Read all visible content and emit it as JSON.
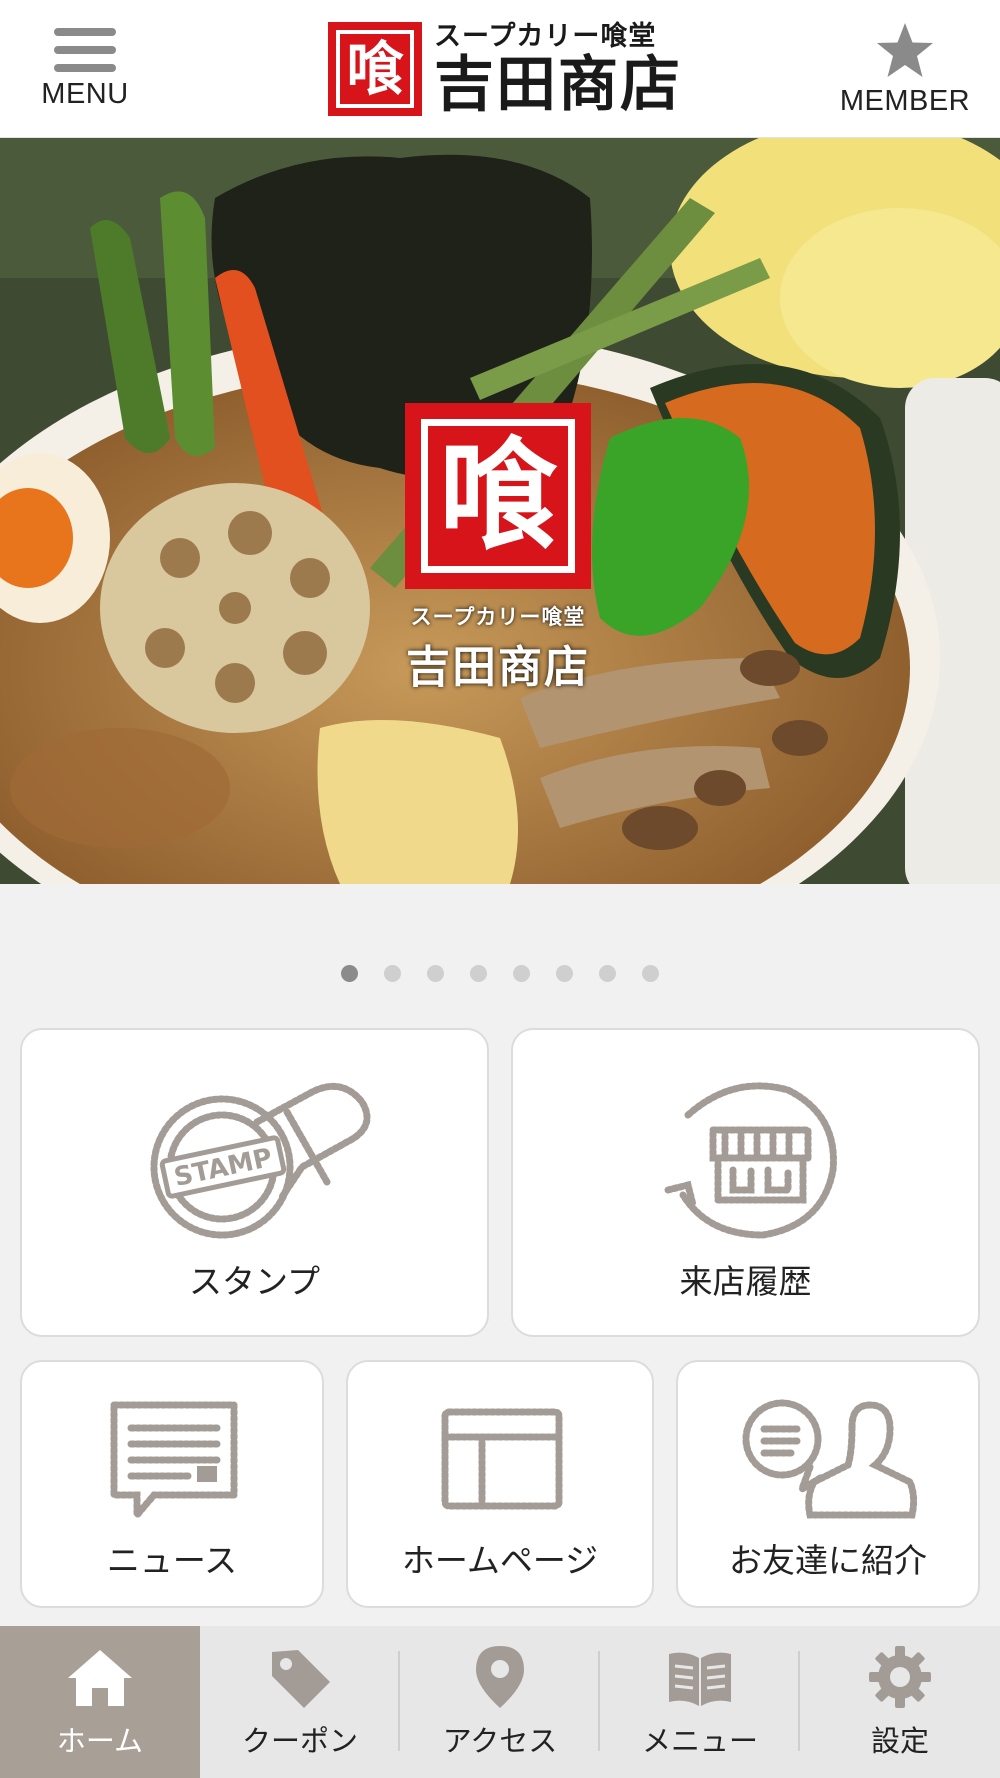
{
  "header": {
    "menu_label": "MENU",
    "member_label": "MEMBER",
    "logo_mark": "喰",
    "logo_sub": "スープカリー喰堂",
    "logo_main": "吉田商店"
  },
  "hero": {
    "logo_mark": "喰",
    "logo_sub": "スープカリー喰堂",
    "logo_main": "吉田商店"
  },
  "carousel": {
    "count": 8,
    "active_index": 0
  },
  "tiles": {
    "stamp": {
      "label": "スタンプ",
      "stamp_text": "STAMP"
    },
    "visit_history": {
      "label": "来店履歴"
    },
    "news": {
      "label": "ニュース"
    },
    "homepage": {
      "label": "ホームページ"
    },
    "refer_friend": {
      "label": "お友達に紹介"
    }
  },
  "bottom_nav": {
    "items": [
      {
        "label": "ホーム",
        "icon": "home-icon"
      },
      {
        "label": "クーポン",
        "icon": "coupon-tag-icon"
      },
      {
        "label": "アクセス",
        "icon": "map-pin-icon"
      },
      {
        "label": "メニュー",
        "icon": "menu-book-icon"
      },
      {
        "label": "設定",
        "icon": "gear-icon"
      }
    ],
    "active_index": 0
  },
  "colors": {
    "brand_red": "#d8141b",
    "icon_gray": "#a39c96",
    "active_nav": "#a89f97"
  }
}
